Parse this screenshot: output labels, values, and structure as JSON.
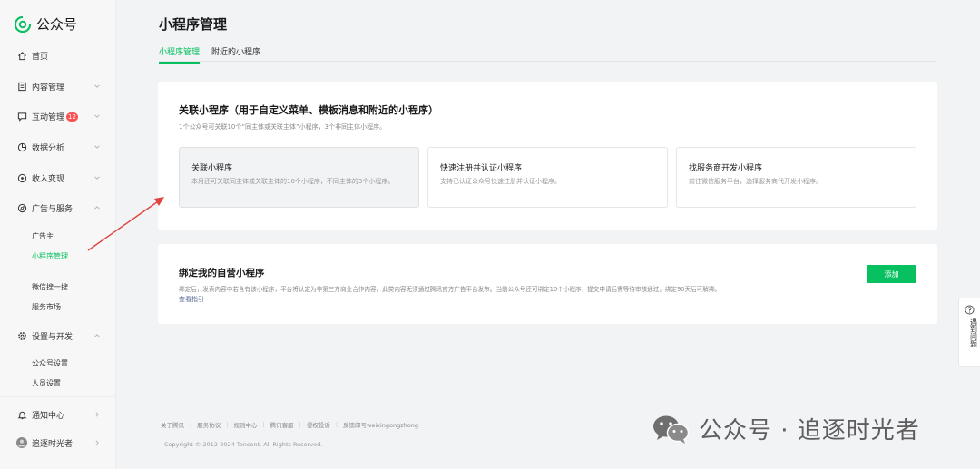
{
  "app": {
    "name": "公众号"
  },
  "sidebar": {
    "items": [
      {
        "label": "首页"
      },
      {
        "label": "内容管理"
      },
      {
        "label": "互动管理",
        "badge": "12"
      },
      {
        "label": "数据分析"
      },
      {
        "label": "收入变现"
      },
      {
        "label": "广告与服务"
      },
      {
        "label": "设置与开发"
      },
      {
        "label": "通知中心"
      },
      {
        "label": "追逐时光者"
      }
    ],
    "sub_items": {
      "ads": [
        "广告主",
        "小程序管理",
        "微信搜一搜",
        "服务市场"
      ],
      "settings": [
        "公众号设置",
        "人员设置"
      ]
    }
  },
  "header": {
    "title": "小程序管理",
    "tabs": [
      "小程序管理",
      "附近的小程序"
    ]
  },
  "link_section": {
    "title": "关联小程序（用于自定义菜单、模板消息和附近的小程序）",
    "desc": "1个公众号可关联10个“同主体或关联主体”小程序，3个非同主体小程序。",
    "options": [
      {
        "title": "关联小程序",
        "desc": "本月还可关联同主体或关联主体的10个小程序，不同主体的3个小程序。"
      },
      {
        "title": "快速注册并认证小程序",
        "desc": "支持已认证公众号快速注册并认证小程序。"
      },
      {
        "title": "找服务商开发小程序",
        "desc": "前往微信服务平台，选择服务商代开发小程序。"
      }
    ]
  },
  "bind_section": {
    "title": "绑定我的自营小程序",
    "desc": "绑定后，发表内容中若含有该小程序，平台将认定为非第三方商业合作内容，此类内容无须通过腾讯官方广告平台发布。当前公众号还可绑定10个小程序，提交申请后需等待审核通过，绑定90天后可解绑。",
    "guide_link": "查看指引",
    "add_button": "添加"
  },
  "footer": {
    "links": [
      "关于腾讯",
      "服务协议",
      "规则中心",
      "腾讯客服",
      "侵权投诉",
      "反馈邮号weixingongzhong"
    ],
    "copyright": "Copyright © 2012-2024 Tencent. All Rights Reserved."
  },
  "help": {
    "label": "遇到问题"
  },
  "watermark": {
    "text": "公众号 · 追逐时光者"
  },
  "colors": {
    "accent": "#07c160",
    "badge": "#fa5151",
    "link": "#576b95",
    "arrow": "#e0443e"
  },
  "icons": {
    "logo": "wechat-official-account-logo",
    "home": "home-icon",
    "content": "document-icon",
    "interaction": "chat-icon",
    "analytics": "pie-chart-icon",
    "revenue": "coin-icon",
    "ads": "compass-icon",
    "settings": "gear-icon",
    "notifications": "bell-icon",
    "user": "avatar",
    "help": "question-circle-icon"
  }
}
